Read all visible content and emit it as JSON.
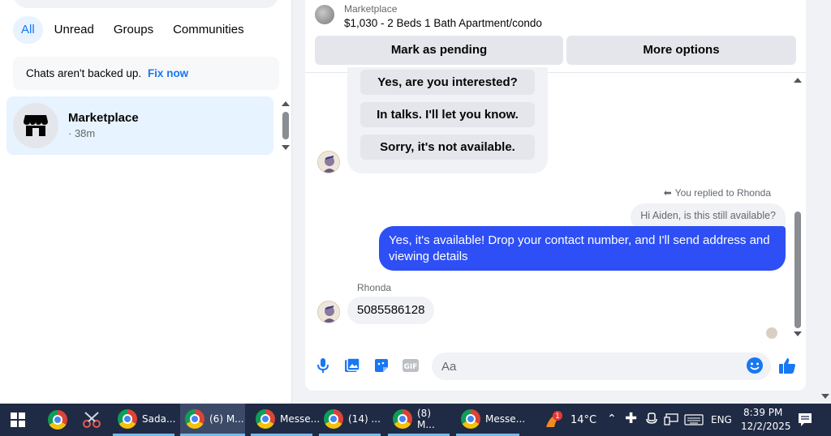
{
  "sidebar": {
    "filters": [
      "All",
      "Unread",
      "Groups",
      "Communities"
    ],
    "backup_text": "Chats aren't backed up.",
    "backup_link": "Fix now",
    "chat": {
      "name": "Marketplace",
      "time": "· 38m"
    }
  },
  "listing": {
    "source": "Marketplace",
    "title": "$1,030 - 2 Beds 1 Bath Apartment/condo",
    "mark_pending": "Mark as pending",
    "more_options": "More options"
  },
  "messages": {
    "choices": [
      "Yes, are you interested?",
      "In talks. I'll let you know.",
      "Sorry, it's not available."
    ],
    "replied_note": "You replied to Rhonda",
    "quoted": "Hi Aiden, is this still available?",
    "my_reply": "Yes, it's available! Drop your contact number, and I'll send address and viewing details",
    "sender": "Rhonda",
    "their_reply": "5085586128"
  },
  "composer": {
    "placeholder": "Aa"
  },
  "taskbar": {
    "apps": [
      {
        "label": "Sada..."
      },
      {
        "label": "(6) M..."
      },
      {
        "label": "Messe..."
      },
      {
        "label": "(14) ..."
      },
      {
        "label": "(8) M..."
      },
      {
        "label": "Messe..."
      }
    ],
    "weather_badge": "1",
    "temperature": "14°C",
    "language": "ENG",
    "time": "8:39 PM",
    "date": "12/2/2025"
  },
  "colors": {
    "accent": "#1877f2",
    "my_bubble": "#2e4ff5",
    "taskbar": "#1f2a44"
  }
}
